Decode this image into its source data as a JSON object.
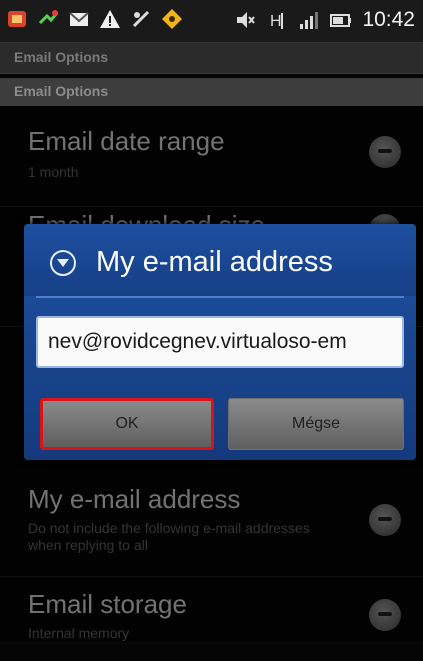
{
  "status_bar": {
    "time": "10:42",
    "icons": [
      "app-icon",
      "missed-call-icon",
      "email-icon",
      "warning-icon",
      "signal-off-icon",
      "diamond-icon",
      "mute-icon",
      "data-icon",
      "signal-icon",
      "battery-icon"
    ]
  },
  "titlebar": {
    "title": "Email Options"
  },
  "subtitlebar": {
    "title": "Email Options"
  },
  "list": {
    "items": [
      {
        "title": "Email date range",
        "subtitle": "1 month"
      },
      {
        "title": "Email download size",
        "subtitle": ""
      },
      {
        "title": "My e-mail address",
        "subtitle": "Do not include the following e-mail addresses when replying to all"
      },
      {
        "title": "Email storage",
        "subtitle": "Internal memory"
      }
    ]
  },
  "dialog": {
    "title": "My e-mail address",
    "email_value": "nev@rovidcegnev.virtualoso-em",
    "ok_label": "OK",
    "cancel_label": "Mégse"
  },
  "colors": {
    "dialog_blue": "#1b4a97",
    "ok_highlight": "#d8141a"
  }
}
